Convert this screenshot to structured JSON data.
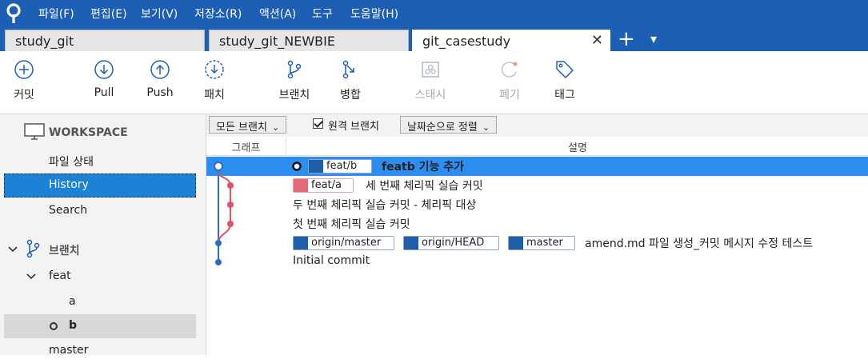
{
  "menu": [
    "파일(F)",
    "편집(E)",
    "보기(V)",
    "저장소(R)",
    "액션(A)",
    "도구",
    "도움말(H)"
  ],
  "tabs": [
    "study_git",
    "study_git_NEWBIE",
    "git_casestudy"
  ],
  "tab_close_glyph": "✕",
  "tab_add_glyph": "+",
  "tab_menu_glyph": "▾",
  "toolbar": {
    "commit": "커밋",
    "pull": "Pull",
    "push": "Push",
    "patch": "패치",
    "branch": "브랜치",
    "merge": "병합",
    "stash": "스태시",
    "discard": "폐기",
    "tag": "태그"
  },
  "sidebar": {
    "workspace": "WORKSPACE",
    "file_status": "파일 상태",
    "history": "History",
    "search": "Search",
    "branches": "브랜치",
    "feat": "feat",
    "a": "a",
    "b": "b",
    "master": "master"
  },
  "filters": {
    "all_branches": "모든 브랜치",
    "remote_branches": "원격 브랜치",
    "sort": "날짜순으로 정렬"
  },
  "columns": {
    "graph": "그래프",
    "description": "설명"
  },
  "commits": [
    {
      "labels": [
        "feat/b"
      ],
      "message": "featb 기능 추가"
    },
    {
      "labels": [
        "feat/a"
      ],
      "message": "세 번째 체리픽 실습 커밋"
    },
    {
      "labels": [],
      "message": "두 번째 체리픽 실습 커밋 - 체리픽 대상"
    },
    {
      "labels": [],
      "message": "첫 번째 체리픽 실습 커밋"
    },
    {
      "labels": [
        "origin/master",
        "origin/HEAD",
        "master"
      ],
      "message": "amend.md 파일 생성_커밋 메시지 수정 테스트"
    },
    {
      "labels": [],
      "message": "Initial commit"
    }
  ],
  "colors": {
    "accent": "#1d5fb4",
    "selection": "#2b8ef0",
    "graph_blue": "#2d6db5",
    "graph_red": "#e0506a"
  }
}
